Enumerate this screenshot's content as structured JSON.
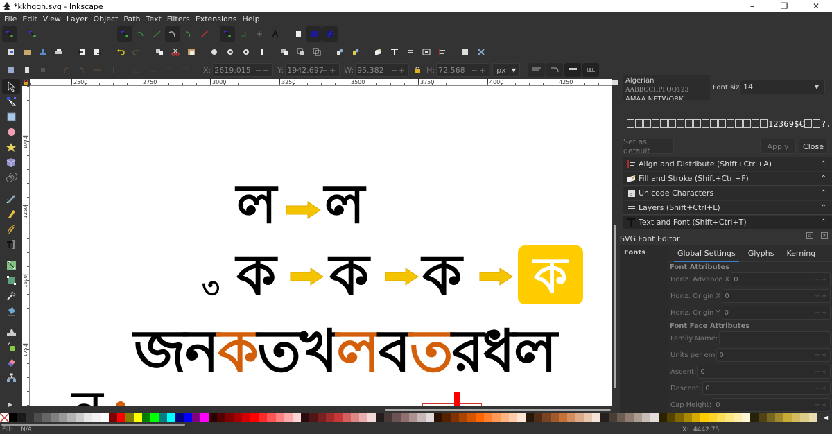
{
  "window": {
    "title": "*kkhggh.svg - Inkscape",
    "controls": {
      "minimize": "–",
      "maximize": "❐",
      "close": "✕"
    }
  },
  "menu": [
    "File",
    "Edit",
    "View",
    "Layer",
    "Object",
    "Path",
    "Text",
    "Filters",
    "Extensions",
    "Help"
  ],
  "snap_toolbar": {
    "icons": [
      "snap-toggle-icon",
      "snap-bbox-icon",
      "snap-nodes-icon",
      "snap-path-icon",
      "snap-cusp-icon",
      "snap-smooth-icon",
      "snap-midpoint-icon",
      "snap-intersection-icon",
      "snap-others-icon",
      "snap-center-icon",
      "snap-rotation-icon",
      "snap-text-baseline-icon",
      "snap-page-icon",
      "snap-grid-icon",
      "snap-guide-icon"
    ]
  },
  "commands_toolbar": {
    "icons": [
      "new-document-icon",
      "open-icon",
      "save-icon",
      "print-icon",
      "import-icon",
      "export-icon",
      "undo-icon",
      "redo-icon",
      "copy-icon",
      "cut-icon",
      "paste-icon",
      "zoom-selection-icon",
      "zoom-drawing-icon",
      "zoom-page-icon",
      "zoom-width-icon",
      "duplicate-icon",
      "clone-icon",
      "unlink-clone-icon",
      "group-icon",
      "ungroup-icon",
      "fill-stroke-icon",
      "text-font-icon",
      "layers-icon",
      "xml-editor-icon",
      "align-icon",
      "document-properties-icon",
      "preferences-icon"
    ]
  },
  "select_toolbar": {
    "x_label": "X:",
    "x_value": "2619.015",
    "y_label": "Y:",
    "y_value": "1942.697",
    "w_label": "W:",
    "w_value": "95.382",
    "h_label": "H:",
    "h_value": "72.568",
    "unit": "px",
    "spin_controls": "−+"
  },
  "tools": [
    "selector-tool-icon",
    "node-tool-icon",
    "rectangle-tool-icon",
    "ellipse-tool-icon",
    "star-tool-icon",
    "3d-box-tool-icon",
    "spiral-tool-icon",
    "pencil-tool-icon",
    "pen-tool-icon",
    "calligraphy-tool-icon",
    "text-tool-icon",
    "gradient-tool-icon",
    "mesh-tool-icon",
    "dropper-tool-icon",
    "paint-bucket-tool-icon",
    "tweak-tool-icon",
    "spray-tool-icon",
    "eraser-tool-icon",
    "connector-tool-icon"
  ],
  "ruler": {
    "horizontal": [
      "2500",
      "2750",
      "3000",
      "3250",
      "3500",
      "3750",
      "4000",
      "4250"
    ],
    "vertical": [
      "1000",
      "1250",
      "1500",
      "1750"
    ]
  },
  "canvas": {
    "row1": [
      "ল",
      "ল"
    ],
    "row2_prefix": "৩",
    "row2": [
      "ক",
      "ক",
      "ক"
    ],
    "app_icon_glyph": "ক",
    "word_segments": [
      {
        "text": "জন",
        "color": "#000000"
      },
      {
        "text": "ক",
        "color": "#d35f0a"
      },
      {
        "text": "তখ",
        "color": "#000000"
      },
      {
        "text": "ল",
        "color": "#d35f0a"
      },
      {
        "text": "ব",
        "color": "#000000"
      },
      {
        "text": "ত",
        "color": "#d35f0a"
      },
      {
        "text": "রধল",
        "color": "#000000"
      }
    ],
    "partial_glyph": "ন",
    "colors": {
      "arrow": "#f5c400",
      "arrow_stroke": "#e0a800",
      "icon_bg": "#ffcc00",
      "accent_orange": "#d35f0a"
    }
  },
  "text_font_panel": {
    "font_name": "Algerian",
    "font_sample": "AABBCCIIPPQQ123",
    "font_name_2": "AMAA NETWORK CONSULTA",
    "font_size_label": "Font size",
    "font_size_value": "14",
    "preview_text": "12369$€",
    "preview_tail": "?.:/()",
    "set_default_label": "Set as default",
    "apply_label": "Apply",
    "close_label": "Close"
  },
  "docked_dialogs": [
    {
      "label": "Align and Distribute (Shift+Ctrl+A)",
      "icon": "align-icon"
    },
    {
      "label": "Fill and Stroke (Shift+Ctrl+F)",
      "icon": "fill-stroke-icon"
    },
    {
      "label": "Unicode Characters",
      "icon": "unicode-icon"
    },
    {
      "label": "Layers (Shift+Ctrl+L)",
      "icon": "layers-icon"
    },
    {
      "label": "Text and Font (Shift+Ctrl+T)",
      "icon": "text-icon"
    }
  ],
  "svg_font_editor": {
    "title": "SVG Font Editor",
    "fonts_header": "Fonts",
    "tabs": [
      "Global Settings",
      "Glyphs",
      "Kerning"
    ],
    "active_tab": "Global Settings",
    "font_attributes_header": "Font Attributes",
    "font_attributes": [
      {
        "label": "Horiz. Advance X",
        "value": "0"
      },
      {
        "label": "Horiz. Origin X",
        "value": "0"
      },
      {
        "label": "Horiz. Origin Y",
        "value": "0"
      }
    ],
    "font_face_header": "Font Face Attributes",
    "family_name_label": "Family Name:",
    "family_name_value": "",
    "font_face_attributes": [
      {
        "label": "Units per em",
        "value": "0"
      },
      {
        "label": "Ascent:",
        "value": "0"
      },
      {
        "label": "Descent:",
        "value": "0"
      },
      {
        "label": "Cap Height:",
        "value": "0"
      }
    ]
  },
  "palette": [
    "#000000",
    "#1a1a1a",
    "#333333",
    "#4d4d4d",
    "#666666",
    "#808080",
    "#999999",
    "#b3b3b3",
    "#cccccc",
    "#e6e6e6",
    "#f2f2f2",
    "#ffffff",
    "#800000",
    "#ff0000",
    "#808000",
    "#ffff00",
    "#008000",
    "#00ff00",
    "#008080",
    "#00ffff",
    "#000080",
    "#0000ff",
    "#800080",
    "#ff00ff",
    "#2b0000",
    "#550000",
    "#800000",
    "#aa0000",
    "#d40000",
    "#ff0000",
    "#ff2a2a",
    "#ff5555",
    "#ff8080",
    "#ffaaaa",
    "#ffd5d5",
    "#280b0b",
    "#501616",
    "#782121",
    "#a02c2c",
    "#c83737",
    "#d35f5f",
    "#de8787",
    "#e9afaf",
    "#f4d7d7",
    "#241c1c",
    "#483737",
    "#6c5353",
    "#916f6f",
    "#ac9393",
    "#c8b7b7",
    "#e3dbdb",
    "#2b1100",
    "#552200",
    "#803300",
    "#aa4400",
    "#d45500",
    "#ff6600",
    "#ff7f2a",
    "#ff9955",
    "#ffb380",
    "#ffccaa",
    "#ffe6d5",
    "#28170b",
    "#502d16",
    "#784421",
    "#a05a2c",
    "#c87137",
    "#d38d5f",
    "#deaa87",
    "#e9c6af",
    "#f4e3d7",
    "#241f1c",
    "#483e37",
    "#6c5d53",
    "#917c6f",
    "#ac9d93",
    "#c8beb7",
    "#e3dedb",
    "#2b2200",
    "#554400",
    "#806600",
    "#aa8800",
    "#d4aa00",
    "#ffcc00",
    "#ffd42a",
    "#ffdd55",
    "#ffe680",
    "#ffeeaa",
    "#fff6d5",
    "#28220b",
    "#504416",
    "#786721",
    "#a0892c",
    "#c8ab37",
    "#d3bc5f",
    "#decd87",
    "#e9ddaf"
  ],
  "status": {
    "fill_label": "Fill:",
    "fill_value": "N/A",
    "coord_label": "X:",
    "coord_value": "4442.75"
  }
}
